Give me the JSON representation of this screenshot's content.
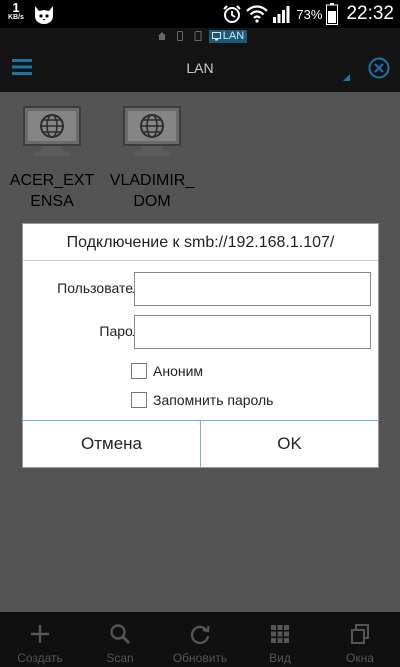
{
  "status_bar": {
    "net_speed_value": "1",
    "net_speed_unit": "KB/s",
    "battery_percent": "73%",
    "time": "22:32"
  },
  "path_bar": {
    "current": "LAN"
  },
  "action_bar": {
    "title": "LAN"
  },
  "hosts": [
    {
      "name": "ACER_EXTENSA"
    },
    {
      "name": "VLADIMIR_DOM"
    }
  ],
  "dialog": {
    "title": "Подключение к smb://192.168.1.107/",
    "user_label": "Пользователь",
    "user_value": "",
    "password_label": "Пароль",
    "password_value": "",
    "anonymous_label": "Аноним",
    "remember_label": "Запомнить пароль",
    "cancel_label": "Отмена",
    "ok_label": "OK"
  },
  "toolbar": {
    "items": [
      {
        "label": "Создать",
        "icon": "plus-icon"
      },
      {
        "label": "Scan",
        "icon": "search-icon"
      },
      {
        "label": "Обновить",
        "icon": "refresh-icon"
      },
      {
        "label": "Вид",
        "icon": "grid-icon"
      },
      {
        "label": "Окна",
        "icon": "windows-icon"
      }
    ]
  },
  "colors": {
    "accent": "#6db7d9",
    "selection": "#1b5979",
    "background": "#545454"
  }
}
